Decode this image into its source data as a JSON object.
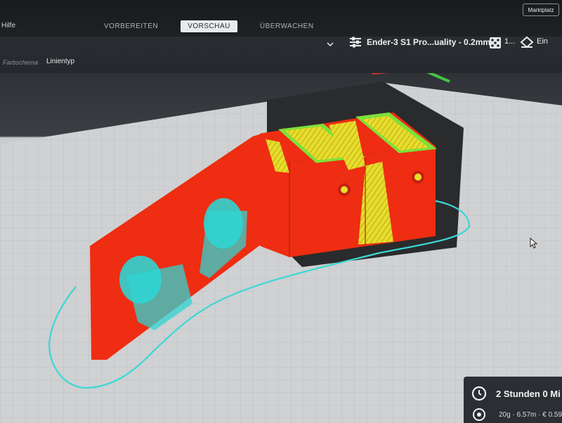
{
  "menu": {
    "help": "Hilfe"
  },
  "tabs": [
    {
      "label": "VORBEREITEN",
      "active": false
    },
    {
      "label": "VORSCHAU",
      "active": true
    },
    {
      "label": "ÜBERWACHEN",
      "active": false
    }
  ],
  "marketplace": {
    "label": "Marktplatz"
  },
  "view_settings": {
    "color_scheme_label": "Farbschema",
    "color_scheme_value": "Linientyp"
  },
  "printer": {
    "name": "Ender-3 S1 Pro...uality - 0.2mm",
    "infill_value": "1...",
    "adhesion_value": "Ein",
    "icons": {
      "settings": "sliders-icon",
      "support": "support-icon",
      "adhesion": "adhesion-icon"
    }
  },
  "estimate": {
    "time": "2 Stunden 0 Mi",
    "material": "20g · 6.57m · € 0.59",
    "icons": {
      "time": "clock-icon",
      "cost": "spool-icon"
    }
  },
  "colors": {
    "wall_outer": "#ee2d12",
    "wall_inner": "#7ee03a",
    "top_bottom": "#e3df2a",
    "support": "#2fd4d1",
    "skirt": "#3ad8d6",
    "axis_x": "#e53935",
    "axis_y": "#43c443",
    "axis_z": "#2f6fe0"
  }
}
